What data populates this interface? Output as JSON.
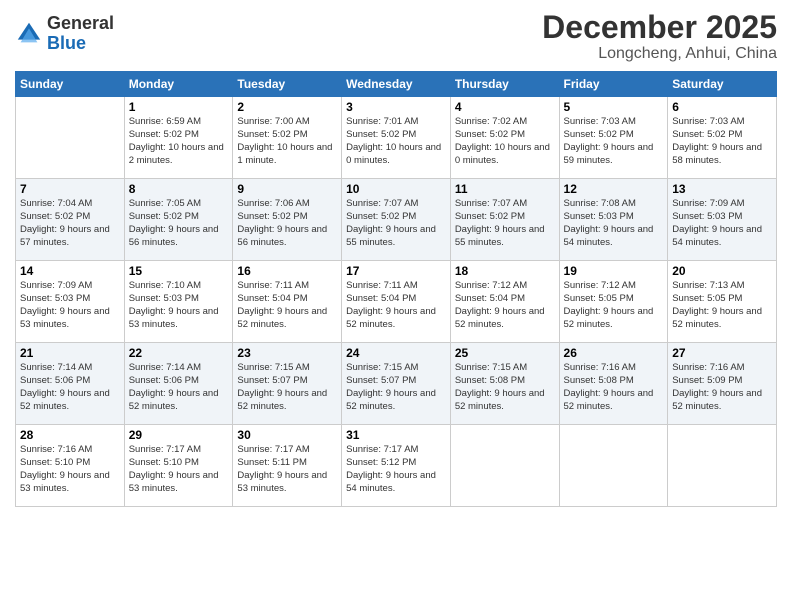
{
  "logo": {
    "general": "General",
    "blue": "Blue"
  },
  "header": {
    "month": "December 2025",
    "location": "Longcheng, Anhui, China"
  },
  "weekdays": [
    "Sunday",
    "Monday",
    "Tuesday",
    "Wednesday",
    "Thursday",
    "Friday",
    "Saturday"
  ],
  "weeks": [
    [
      {
        "day": "",
        "info": ""
      },
      {
        "day": "1",
        "info": "Sunrise: 6:59 AM\nSunset: 5:02 PM\nDaylight: 10 hours\nand 2 minutes."
      },
      {
        "day": "2",
        "info": "Sunrise: 7:00 AM\nSunset: 5:02 PM\nDaylight: 10 hours\nand 1 minute."
      },
      {
        "day": "3",
        "info": "Sunrise: 7:01 AM\nSunset: 5:02 PM\nDaylight: 10 hours\nand 0 minutes."
      },
      {
        "day": "4",
        "info": "Sunrise: 7:02 AM\nSunset: 5:02 PM\nDaylight: 10 hours\nand 0 minutes."
      },
      {
        "day": "5",
        "info": "Sunrise: 7:03 AM\nSunset: 5:02 PM\nDaylight: 9 hours\nand 59 minutes."
      },
      {
        "day": "6",
        "info": "Sunrise: 7:03 AM\nSunset: 5:02 PM\nDaylight: 9 hours\nand 58 minutes."
      }
    ],
    [
      {
        "day": "7",
        "info": "Sunrise: 7:04 AM\nSunset: 5:02 PM\nDaylight: 9 hours\nand 57 minutes."
      },
      {
        "day": "8",
        "info": "Sunrise: 7:05 AM\nSunset: 5:02 PM\nDaylight: 9 hours\nand 56 minutes."
      },
      {
        "day": "9",
        "info": "Sunrise: 7:06 AM\nSunset: 5:02 PM\nDaylight: 9 hours\nand 56 minutes."
      },
      {
        "day": "10",
        "info": "Sunrise: 7:07 AM\nSunset: 5:02 PM\nDaylight: 9 hours\nand 55 minutes."
      },
      {
        "day": "11",
        "info": "Sunrise: 7:07 AM\nSunset: 5:02 PM\nDaylight: 9 hours\nand 55 minutes."
      },
      {
        "day": "12",
        "info": "Sunrise: 7:08 AM\nSunset: 5:03 PM\nDaylight: 9 hours\nand 54 minutes."
      },
      {
        "day": "13",
        "info": "Sunrise: 7:09 AM\nSunset: 5:03 PM\nDaylight: 9 hours\nand 54 minutes."
      }
    ],
    [
      {
        "day": "14",
        "info": "Sunrise: 7:09 AM\nSunset: 5:03 PM\nDaylight: 9 hours\nand 53 minutes."
      },
      {
        "day": "15",
        "info": "Sunrise: 7:10 AM\nSunset: 5:03 PM\nDaylight: 9 hours\nand 53 minutes."
      },
      {
        "day": "16",
        "info": "Sunrise: 7:11 AM\nSunset: 5:04 PM\nDaylight: 9 hours\nand 52 minutes."
      },
      {
        "day": "17",
        "info": "Sunrise: 7:11 AM\nSunset: 5:04 PM\nDaylight: 9 hours\nand 52 minutes."
      },
      {
        "day": "18",
        "info": "Sunrise: 7:12 AM\nSunset: 5:04 PM\nDaylight: 9 hours\nand 52 minutes."
      },
      {
        "day": "19",
        "info": "Sunrise: 7:12 AM\nSunset: 5:05 PM\nDaylight: 9 hours\nand 52 minutes."
      },
      {
        "day": "20",
        "info": "Sunrise: 7:13 AM\nSunset: 5:05 PM\nDaylight: 9 hours\nand 52 minutes."
      }
    ],
    [
      {
        "day": "21",
        "info": "Sunrise: 7:14 AM\nSunset: 5:06 PM\nDaylight: 9 hours\nand 52 minutes."
      },
      {
        "day": "22",
        "info": "Sunrise: 7:14 AM\nSunset: 5:06 PM\nDaylight: 9 hours\nand 52 minutes."
      },
      {
        "day": "23",
        "info": "Sunrise: 7:15 AM\nSunset: 5:07 PM\nDaylight: 9 hours\nand 52 minutes."
      },
      {
        "day": "24",
        "info": "Sunrise: 7:15 AM\nSunset: 5:07 PM\nDaylight: 9 hours\nand 52 minutes."
      },
      {
        "day": "25",
        "info": "Sunrise: 7:15 AM\nSunset: 5:08 PM\nDaylight: 9 hours\nand 52 minutes."
      },
      {
        "day": "26",
        "info": "Sunrise: 7:16 AM\nSunset: 5:08 PM\nDaylight: 9 hours\nand 52 minutes."
      },
      {
        "day": "27",
        "info": "Sunrise: 7:16 AM\nSunset: 5:09 PM\nDaylight: 9 hours\nand 52 minutes."
      }
    ],
    [
      {
        "day": "28",
        "info": "Sunrise: 7:16 AM\nSunset: 5:10 PM\nDaylight: 9 hours\nand 53 minutes."
      },
      {
        "day": "29",
        "info": "Sunrise: 7:17 AM\nSunset: 5:10 PM\nDaylight: 9 hours\nand 53 minutes."
      },
      {
        "day": "30",
        "info": "Sunrise: 7:17 AM\nSunset: 5:11 PM\nDaylight: 9 hours\nand 53 minutes."
      },
      {
        "day": "31",
        "info": "Sunrise: 7:17 AM\nSunset: 5:12 PM\nDaylight: 9 hours\nand 54 minutes."
      },
      {
        "day": "",
        "info": ""
      },
      {
        "day": "",
        "info": ""
      },
      {
        "day": "",
        "info": ""
      }
    ]
  ]
}
